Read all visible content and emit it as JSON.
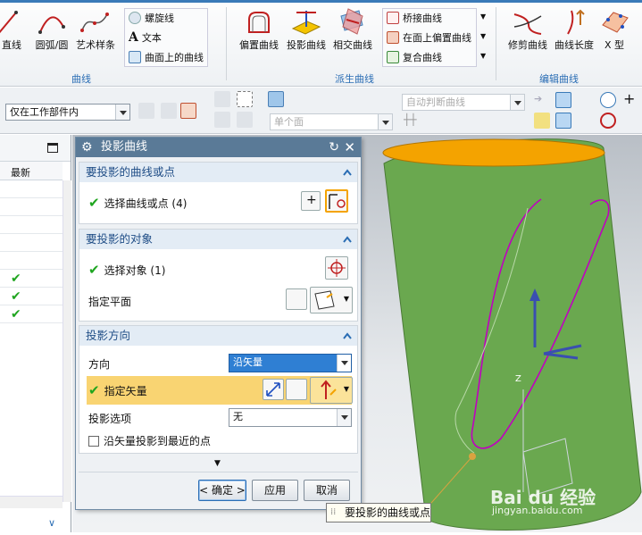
{
  "ribbon": {
    "curve_group": {
      "label": "曲线",
      "line": "直线",
      "arc": "圆弧/圆",
      "spline": "艺术样条",
      "helix": "螺旋线",
      "text": "文本",
      "curve_on_face": "曲面上的曲线"
    },
    "derived_group": {
      "label": "派生曲线",
      "offset": "偏置曲线",
      "project": "投影曲线",
      "intersect": "相交曲线",
      "bridge": "桥接曲线",
      "offset_in_face": "在面上偏置曲线",
      "composite": "复合曲线"
    },
    "edit_group": {
      "label": "编辑曲线",
      "trim": "修剪曲线",
      "length": "曲线长度",
      "x_form": "X 型"
    }
  },
  "toolbar2": {
    "filter_scope": "仅在工作部件内",
    "face_rule": "单个面",
    "curve_rule": "自动判断曲线"
  },
  "left_panel": {
    "column_header": "最新",
    "checked_rows": [
      "✔",
      "✔",
      "✔"
    ]
  },
  "dialog": {
    "title": "投影曲线",
    "section_curves": {
      "title": "要投影的曲线或点",
      "select_label": "选择曲线或点 (4)"
    },
    "section_target": {
      "title": "要投影的对象",
      "select_label": "选择对象 (1)",
      "plane_label": "指定平面"
    },
    "section_direction": {
      "title": "投影方向",
      "direction_label": "方向",
      "direction_value": "沿矢量",
      "vector_label": "指定矢量",
      "option_label": "投影选项",
      "option_value": "无",
      "checkbox_label": "沿矢量投影到最近的点"
    },
    "buttons": {
      "ok": "< 确定 >",
      "apply": "应用",
      "cancel": "取消"
    }
  },
  "tooltip": "要投影的曲线或点",
  "watermark": {
    "brand": "Bai du 经验",
    "url": "jingyan.baidu.com"
  },
  "colors": {
    "dialog_title_bar": "#5a7a97",
    "section_header_text": "#1f4d86",
    "highlight_row": "#f9d472",
    "cylinder_green": "#6aa84f",
    "cylinder_top": "#f4a300",
    "projected_curve": "#c000c0",
    "check_green": "#1fa51f"
  }
}
